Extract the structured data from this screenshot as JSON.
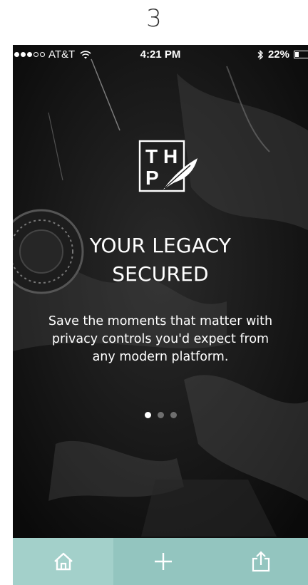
{
  "page_number": "3",
  "status_bar": {
    "carrier": "AT&T",
    "time": "4:21 PM",
    "battery": "22%",
    "battery_level": 0.22,
    "signal_bars_filled": 3,
    "signal_bars_total": 5,
    "icons": [
      "wifi-icon",
      "bluetooth-icon",
      "battery-icon"
    ]
  },
  "logo": {
    "letters": "THP",
    "icon": "quill-feather-icon"
  },
  "headline": {
    "line1": "YOUR LEGACY",
    "line2": "SECURED"
  },
  "body": {
    "line1": "Save the moments that matter with",
    "line2": "privacy controls you'd expect from",
    "line3": "any modern platform."
  },
  "pager": {
    "total": 3,
    "active_index": 0
  },
  "tab_bar": {
    "items": [
      {
        "name": "home",
        "icon": "home-icon",
        "selected": true
      },
      {
        "name": "add",
        "icon": "plus-icon",
        "selected": false
      },
      {
        "name": "share",
        "icon": "share-icon",
        "selected": false
      }
    ]
  },
  "colors": {
    "background": "#0f0f0f",
    "text": "#ffffff",
    "tab_bar": "#93c5bf",
    "tab_selected": "#a3d0ca",
    "pager_inactive": "#6e6e6e"
  }
}
